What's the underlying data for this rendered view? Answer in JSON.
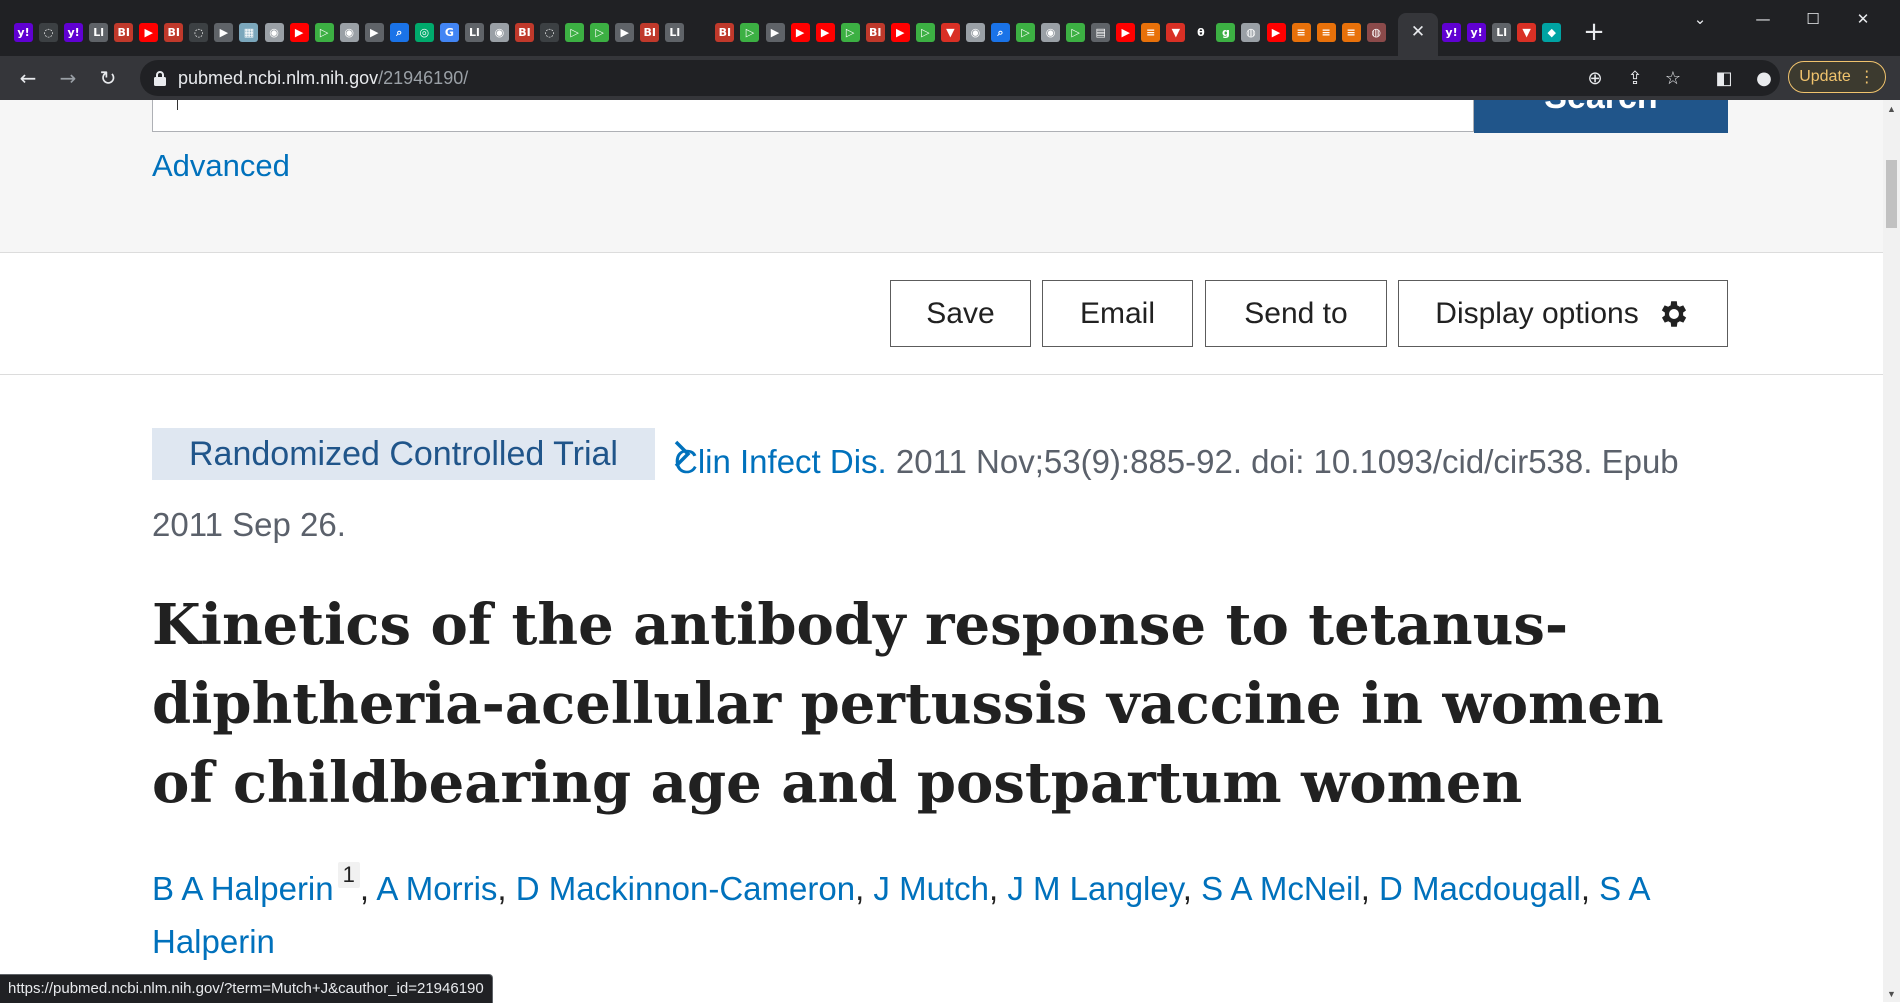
{
  "browser": {
    "tabs_favicons": [
      {
        "icon": "yahoo-icon",
        "color": "#6001d2",
        "glyph": "y!"
      },
      {
        "icon": "shield-icon",
        "color": "#3c4043",
        "glyph": "◌"
      },
      {
        "icon": "yahoo-icon",
        "color": "#6001d2",
        "glyph": "y!"
      },
      {
        "icon": "newspaper-icon",
        "color": "#5f6368",
        "glyph": "Ll"
      },
      {
        "icon": "business-insider-icon",
        "color": "#c0392b",
        "glyph": "BI"
      },
      {
        "icon": "youtube-icon",
        "color": "#ff0000",
        "glyph": "▶"
      },
      {
        "icon": "business-insider-icon",
        "color": "#c0392b",
        "glyph": "BI"
      },
      {
        "icon": "shield-icon",
        "color": "#3c4043",
        "glyph": "◌"
      },
      {
        "icon": "arrow-icon",
        "color": "#5f6368",
        "glyph": "▶"
      },
      {
        "icon": "grid-icon",
        "color": "#7ba7bc",
        "glyph": "▦"
      },
      {
        "icon": "globe-icon",
        "color": "#9aa0a6",
        "glyph": "◉"
      },
      {
        "icon": "youtube-icon",
        "color": "#ff0000",
        "glyph": "▶"
      },
      {
        "icon": "play-icon",
        "color": "#3cb043",
        "glyph": "▷"
      },
      {
        "icon": "globe-icon",
        "color": "#9aa0a6",
        "glyph": "◉"
      },
      {
        "icon": "arrow-icon",
        "color": "#5f6368",
        "glyph": "▶"
      },
      {
        "icon": "search-icon",
        "color": "#1a73e8",
        "glyph": "⌕"
      },
      {
        "icon": "tripadvisor-icon",
        "color": "#00aa6c",
        "glyph": "◎"
      },
      {
        "icon": "google-icon",
        "color": "#4285f4",
        "glyph": "G"
      },
      {
        "icon": "newspaper-icon",
        "color": "#5f6368",
        "glyph": "Ll"
      },
      {
        "icon": "globe-icon",
        "color": "#9aa0a6",
        "glyph": "◉"
      },
      {
        "icon": "business-insider-icon",
        "color": "#c0392b",
        "glyph": "BI"
      },
      {
        "icon": "shield-icon",
        "color": "#3c4043",
        "glyph": "◌"
      },
      {
        "icon": "play-icon",
        "color": "#3cb043",
        "glyph": "▷"
      },
      {
        "icon": "play-icon",
        "color": "#3cb043",
        "glyph": "▷"
      },
      {
        "icon": "arrow-icon",
        "color": "#5f6368",
        "glyph": "▶"
      },
      {
        "icon": "business-insider-icon",
        "color": "#c0392b",
        "glyph": "BI"
      },
      {
        "icon": "newspaper-icon",
        "color": "#5f6368",
        "glyph": "Ll"
      },
      {
        "icon": "blank-icon",
        "color": "#202124",
        "glyph": ""
      },
      {
        "icon": "business-insider-icon",
        "color": "#c0392b",
        "glyph": "BI"
      },
      {
        "icon": "play-icon",
        "color": "#3cb043",
        "glyph": "▷"
      },
      {
        "icon": "arrow-icon",
        "color": "#5f6368",
        "glyph": "▶"
      },
      {
        "icon": "youtube-icon",
        "color": "#ff0000",
        "glyph": "▶"
      },
      {
        "icon": "youtube-icon",
        "color": "#ff0000",
        "glyph": "▶"
      },
      {
        "icon": "play-icon",
        "color": "#3cb043",
        "glyph": "▷"
      },
      {
        "icon": "business-insider-icon",
        "color": "#c0392b",
        "glyph": "BI"
      },
      {
        "icon": "youtube-icon",
        "color": "#ff0000",
        "glyph": "▶"
      },
      {
        "icon": "play-icon",
        "color": "#3cb043",
        "glyph": "▷"
      },
      {
        "icon": "flag-icon",
        "color": "#d93025",
        "glyph": "▼"
      },
      {
        "icon": "globe-icon",
        "color": "#9aa0a6",
        "glyph": "◉"
      },
      {
        "icon": "search-icon",
        "color": "#1a73e8",
        "glyph": "⌕"
      },
      {
        "icon": "play-icon",
        "color": "#3cb043",
        "glyph": "▷"
      },
      {
        "icon": "globe-icon",
        "color": "#9aa0a6",
        "glyph": "◉"
      },
      {
        "icon": "play-icon",
        "color": "#3cb043",
        "glyph": "▷"
      },
      {
        "icon": "news-icon",
        "color": "#5f6368",
        "glyph": "▤"
      },
      {
        "icon": "youtube-icon",
        "color": "#ff0000",
        "glyph": "▶"
      },
      {
        "icon": "bookmark-icon",
        "color": "#e8710a",
        "glyph": "≡"
      },
      {
        "icon": "flag-icon",
        "color": "#d93025",
        "glyph": "▼"
      },
      {
        "icon": "theta-icon",
        "color": "#202124",
        "glyph": "θ"
      },
      {
        "icon": "goodreads-icon",
        "color": "#3cb043",
        "glyph": "g"
      },
      {
        "icon": "avatar-icon",
        "color": "#9aa0a6",
        "glyph": "◍"
      },
      {
        "icon": "youtube-icon",
        "color": "#ff0000",
        "glyph": "▶"
      },
      {
        "icon": "bookmark-icon",
        "color": "#e8710a",
        "glyph": "≡"
      },
      {
        "icon": "bookmark-icon",
        "color": "#e8710a",
        "glyph": "≡"
      },
      {
        "icon": "bookmark-icon",
        "color": "#e8710a",
        "glyph": "≡"
      },
      {
        "icon": "portrait-icon",
        "color": "#8b4a4a",
        "glyph": "◍"
      }
    ],
    "tabs_favicons_after": [
      {
        "icon": "yahoo-icon",
        "color": "#6001d2",
        "glyph": "y!"
      },
      {
        "icon": "yahoo-icon",
        "color": "#6001d2",
        "glyph": "y!"
      },
      {
        "icon": "newspaper-icon",
        "color": "#5f6368",
        "glyph": "Ll"
      },
      {
        "icon": "flag-icon",
        "color": "#d93025",
        "glyph": "▼"
      },
      {
        "icon": "teal-icon",
        "color": "#00a3a3",
        "glyph": "◆"
      }
    ],
    "url_host": "pubmed.ncbi.nlm.nih.gov",
    "url_path": "/21946190/",
    "update_label": "Update",
    "status_url": "https://pubmed.ncbi.nlm.nih.gov/?term=Mutch+J&cauthor_id=21946190"
  },
  "page": {
    "search_button_label": "Search",
    "advanced_label": "Advanced",
    "actions": {
      "save": "Save",
      "email": "Email",
      "send_to": "Send to",
      "display_options": "Display options"
    },
    "pub_type": "Randomized Controlled Trial",
    "citation": {
      "journal": "Clin Infect Dis.",
      "details": " 2011 Nov;53(9):885-92. doi: 10.1093/cid/cir538. Epub 2011 Sep 26."
    },
    "title": "Kinetics of the antibody response to tetanus-diphtheria-acellular pertussis vaccine in women of childbearing age and postpartum women",
    "authors": [
      {
        "name": "B A Halperin",
        "affiliation": "1"
      },
      {
        "name": "A Morris"
      },
      {
        "name": "D Mackinnon-Cameron"
      },
      {
        "name": "J Mutch"
      },
      {
        "name": "J M Langley"
      },
      {
        "name": "S A McNeil"
      },
      {
        "name": "D Macdougall"
      },
      {
        "name": "S A Halperin"
      }
    ]
  },
  "colors": {
    "link": "#0071bc",
    "pub_type_bg": "#dfe7f1",
    "search_button": "#20558a",
    "chrome_dark": "#202124",
    "toolbar": "#35363a"
  }
}
